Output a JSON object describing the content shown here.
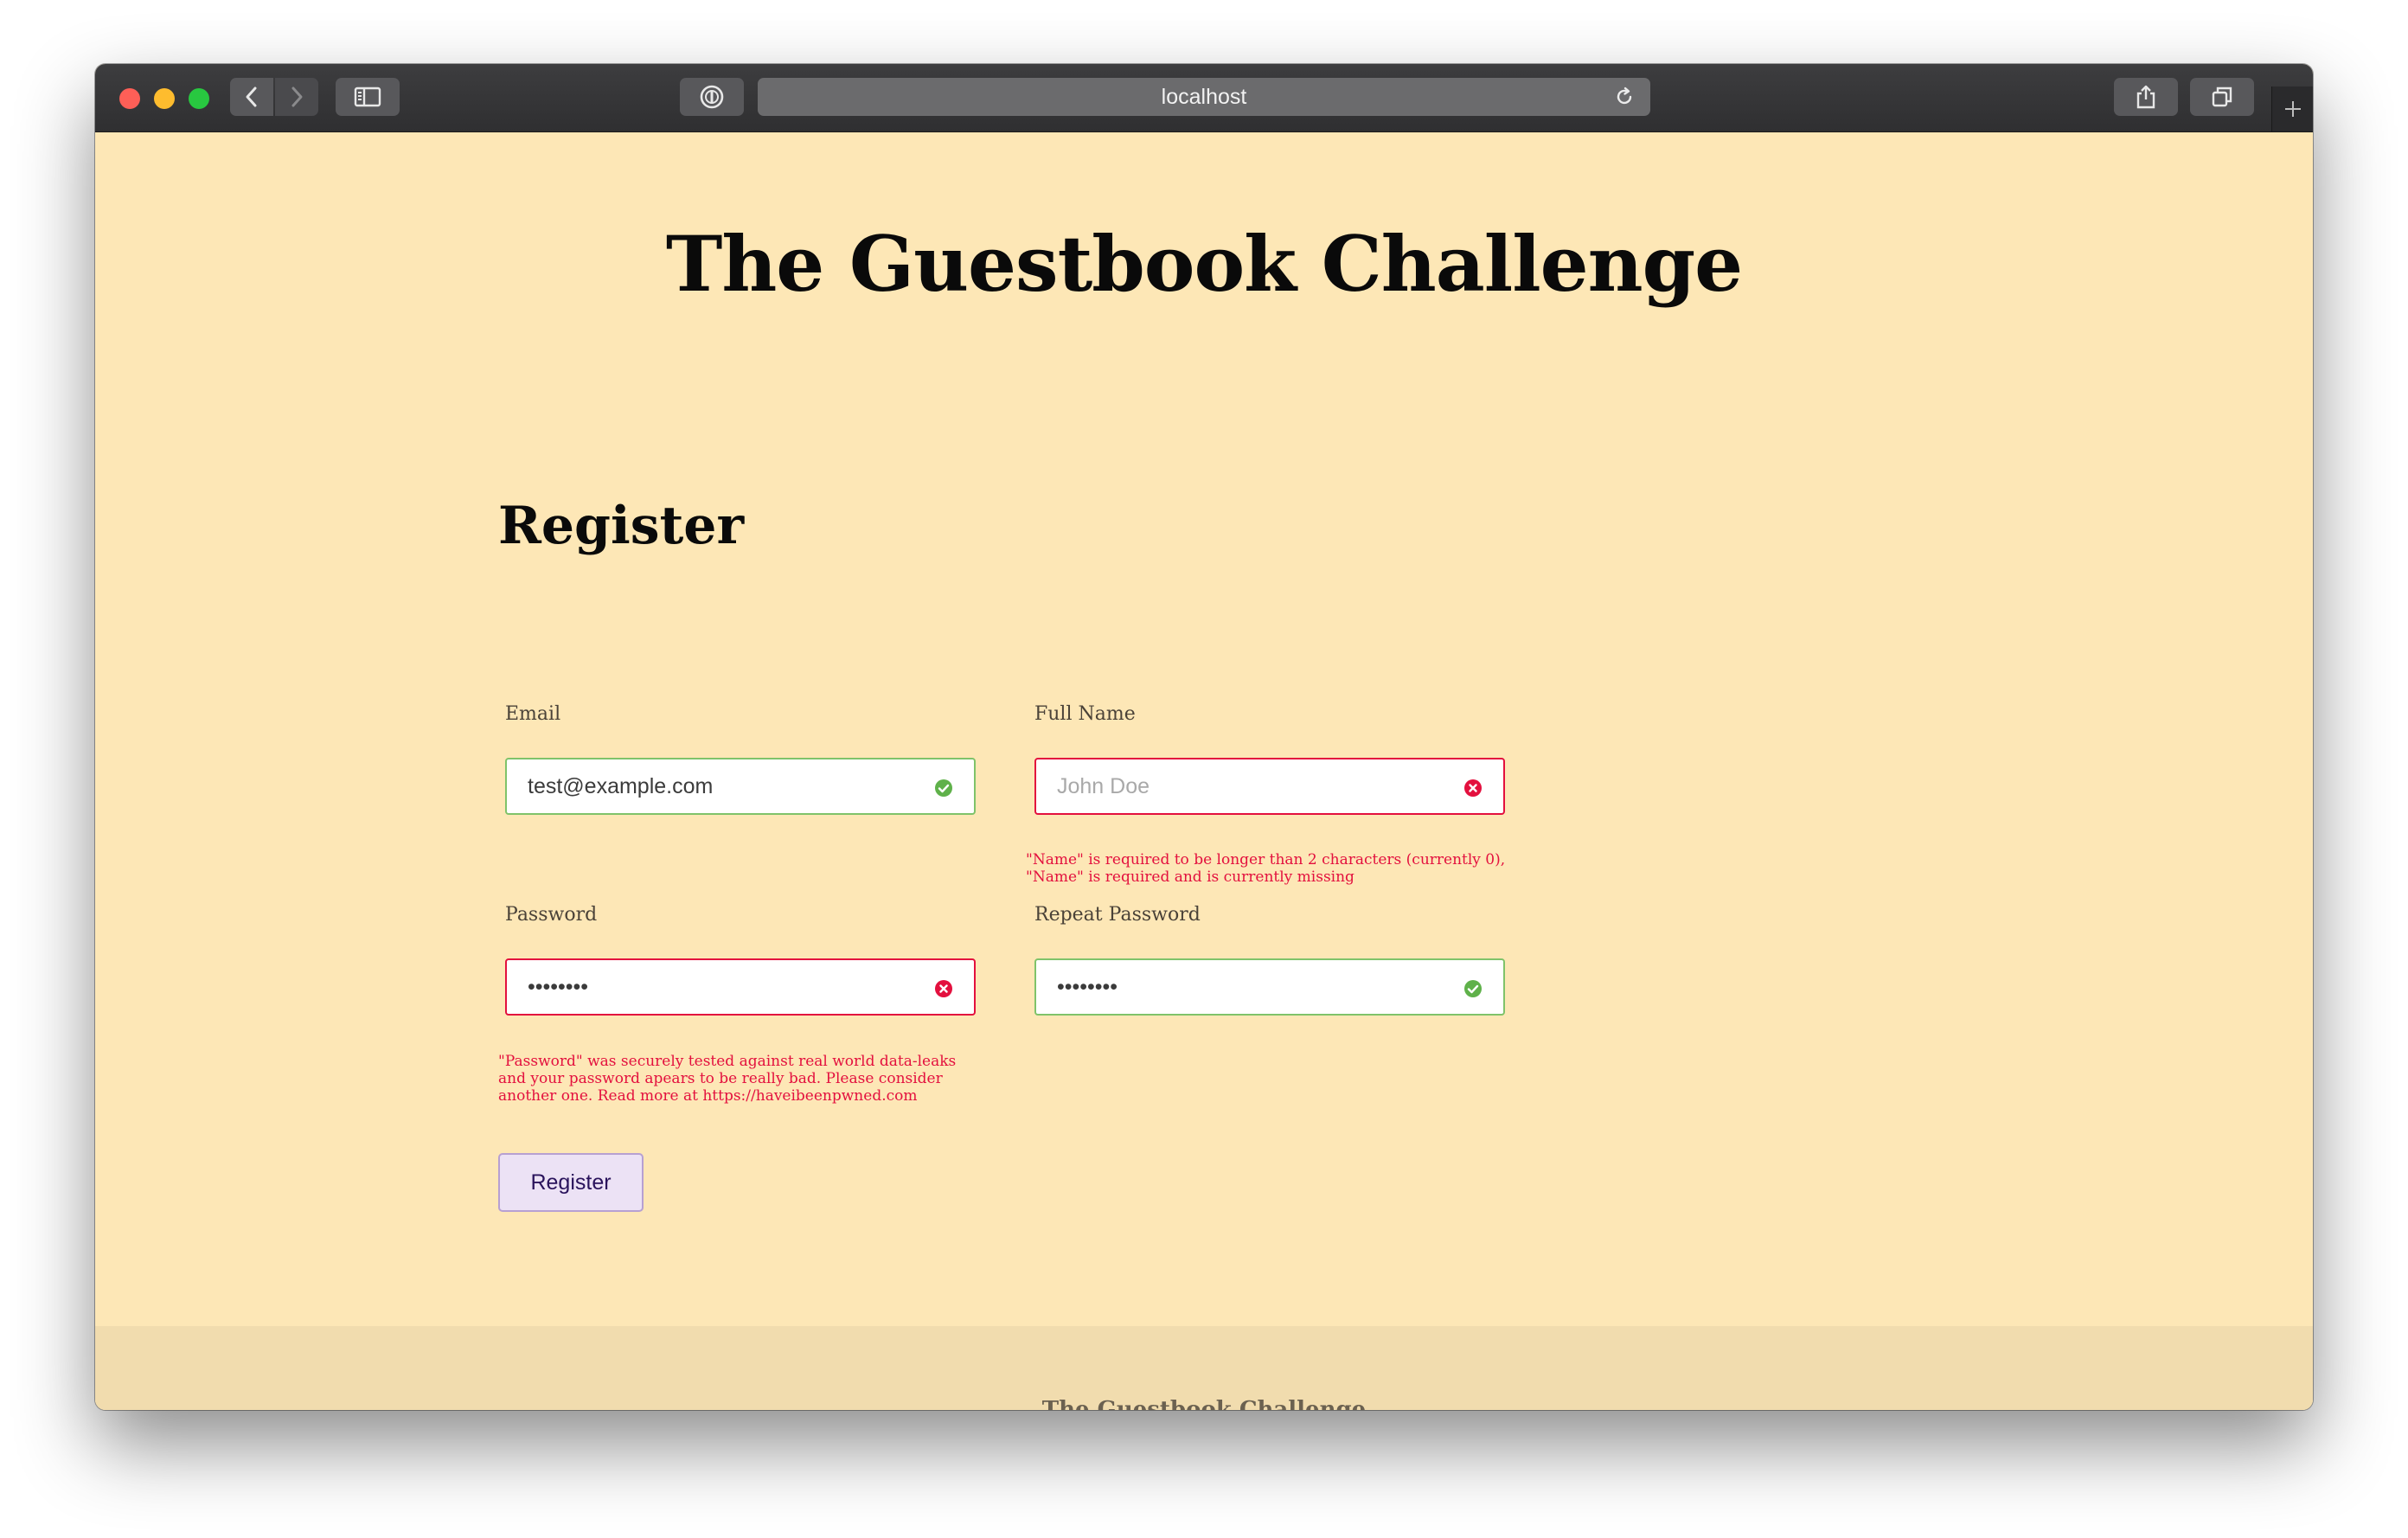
{
  "browser": {
    "url": "localhost"
  },
  "page": {
    "site_title": "The Guestbook Challenge",
    "form_title": "Register",
    "fields": {
      "email": {
        "label": "Email",
        "value": "test@example.com",
        "placeholder": "",
        "status": "valid"
      },
      "full_name": {
        "label": "Full Name",
        "value": "",
        "placeholder": "John Doe",
        "status": "invalid"
      },
      "password": {
        "label": "Password",
        "value": "••••••••",
        "placeholder": "",
        "status": "invalid"
      },
      "repeat_password": {
        "label": "Repeat Password",
        "value": "••••••••",
        "placeholder": "",
        "status": "valid"
      }
    },
    "errors": {
      "full_name_line1": "\"Name\" is required to be longer than 2 characters (currently 0),",
      "full_name_line2": "\"Name\" is required and is currently missing",
      "password_line1": "\"Password\" was securely tested against real world data-leaks",
      "password_line2": "and your password apears to be really bad. Please consider",
      "password_line3": "another one. Read more at https://haveibeenpwned.com"
    },
    "register_button": "Register",
    "footer_text": "The Guestbook Challenge"
  },
  "colors": {
    "page_background": "#fde7b6",
    "valid": "#7fc36a",
    "invalid": "#e3103e",
    "button_background": "#ece2f5"
  }
}
